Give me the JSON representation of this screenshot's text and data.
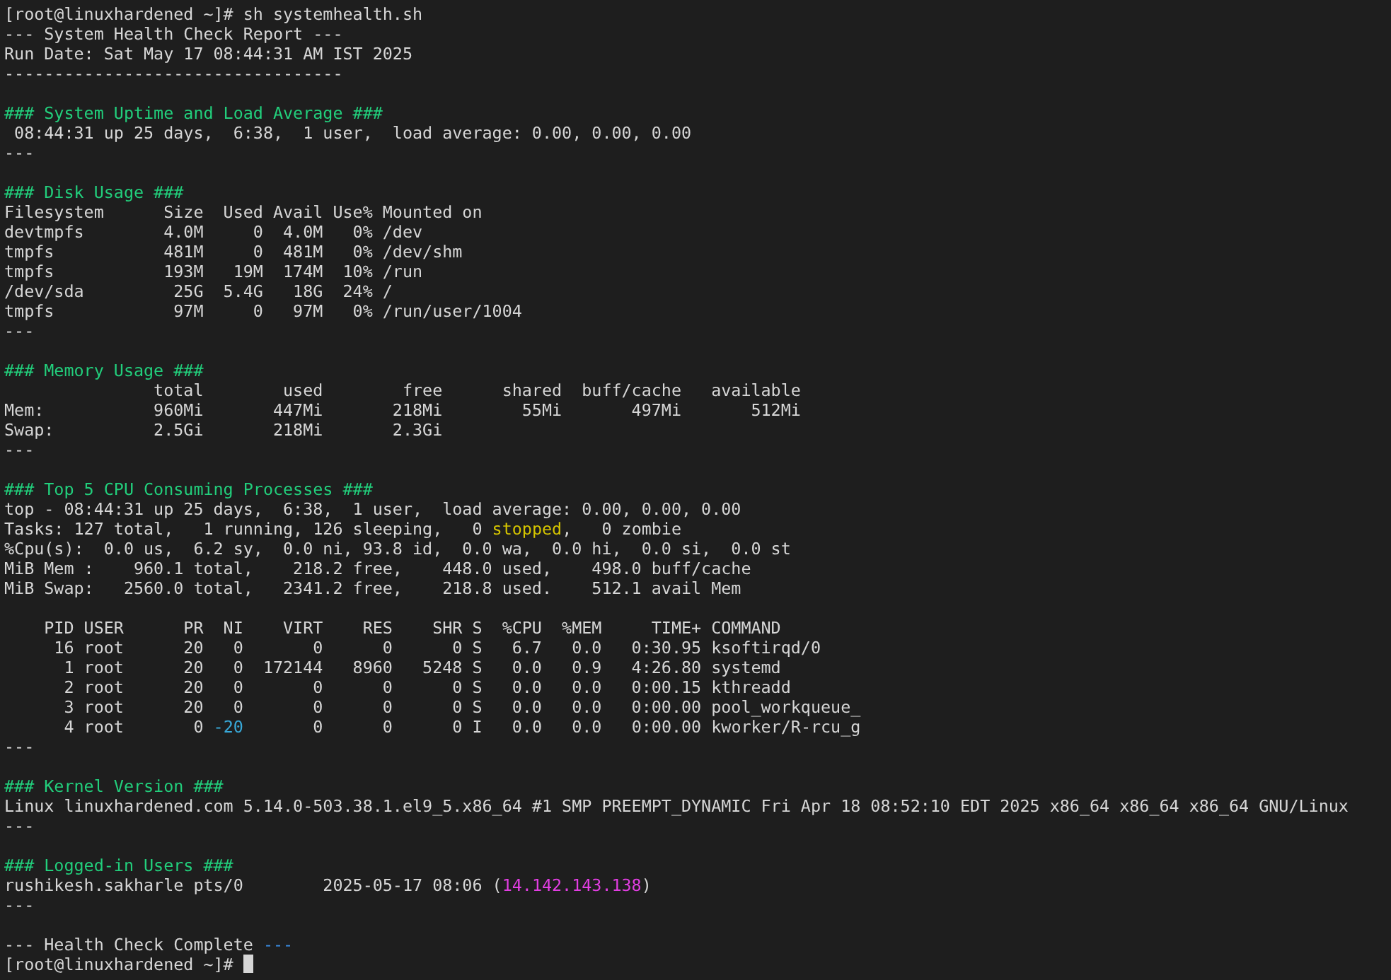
{
  "command_prompt": {
    "prompt": "[root@linuxhardened ~]#",
    "command": "sh systemhealth.sh"
  },
  "report_header": [
    "--- System Health Check Report ---",
    "Run Date: Sat May 17 08:44:31 AM IST 2025",
    "----------------------------------"
  ],
  "sections": [
    {
      "heading": "### System Uptime and Load Average ###",
      "blocks": [
        [
          {
            "parts": [
              {
                "text": " 08:44:31 up 25 days,  6:38,  1 user,  load average: 0.00, 0.00, 0.00",
                "kind": "plain"
              }
            ]
          }
        ]
      ],
      "end": "---"
    },
    {
      "heading": "### Disk Usage ###",
      "blocks": [
        [
          {
            "parts": [
              {
                "text": "Filesystem      Size  Used Avail Use% Mounted on",
                "kind": "plain"
              }
            ]
          },
          {
            "parts": [
              {
                "text": "devtmpfs        4.0M     0  4.0M   0% /dev",
                "kind": "plain"
              }
            ]
          },
          {
            "parts": [
              {
                "text": "tmpfs           481M     0  481M   0% /dev/shm",
                "kind": "plain"
              }
            ]
          },
          {
            "parts": [
              {
                "text": "tmpfs           193M   19M  174M  10% /run",
                "kind": "plain"
              }
            ]
          },
          {
            "parts": [
              {
                "text": "/dev/sda         25G  5.4G   18G  24% /",
                "kind": "plain"
              }
            ]
          },
          {
            "parts": [
              {
                "text": "tmpfs            97M     0   97M   0% /run/user/1004",
                "kind": "plain"
              }
            ]
          }
        ]
      ],
      "end": "---"
    },
    {
      "heading": "### Memory Usage ###",
      "blocks": [
        [
          {
            "parts": [
              {
                "text": "               total        used        free      shared  buff/cache   available",
                "kind": "plain"
              }
            ]
          },
          {
            "parts": [
              {
                "text": "Mem:           960Mi       447Mi       218Mi        55Mi       497Mi       512Mi",
                "kind": "plain"
              }
            ]
          },
          {
            "parts": [
              {
                "text": "Swap:          2.5Gi       218Mi       2.3Gi",
                "kind": "plain"
              }
            ]
          }
        ]
      ],
      "end": "---"
    },
    {
      "heading": "### Top 5 CPU Consuming Processes ###",
      "blocks": [
        [
          {
            "parts": [
              {
                "text": "top - 08:44:31 up 25 days,  6:38,  1 user,  load average: 0.00, 0.00, 0.00",
                "kind": "plain"
              }
            ]
          },
          {
            "parts": [
              {
                "text": "Tasks: 127 total,   1 running, 126 sleeping,   0 ",
                "kind": "plain"
              },
              {
                "text": "stopped",
                "kind": "warning"
              },
              {
                "text": ",   0 zombie",
                "kind": "plain"
              }
            ]
          },
          {
            "parts": [
              {
                "text": "%Cpu(s):  0.0 us,  6.2 sy,  0.0 ni, 93.8 id,  0.0 wa,  0.0 hi,  0.0 si,  0.0 st",
                "kind": "plain"
              }
            ]
          },
          {
            "parts": [
              {
                "text": "MiB Mem :    960.1 total,    218.2 free,    448.0 used,    498.0 buff/cache",
                "kind": "plain"
              }
            ]
          },
          {
            "parts": [
              {
                "text": "MiB Swap:   2560.0 total,   2341.2 free,    218.8 used.    512.1 avail Mem",
                "kind": "plain"
              }
            ]
          }
        ],
        [
          {
            "parts": [
              {
                "text": "    PID USER      PR  NI    VIRT    RES    SHR S  %CPU  %MEM     TIME+ COMMAND",
                "kind": "plain"
              }
            ]
          },
          {
            "parts": [
              {
                "text": "     16 root      20   0       0      0      0 S   6.7   0.0   0:30.95 ksoftirqd/0",
                "kind": "plain"
              }
            ]
          },
          {
            "parts": [
              {
                "text": "      1 root      20   0  172144   8960   5248 S   0.0   0.9   4:26.80 systemd",
                "kind": "plain"
              }
            ]
          },
          {
            "parts": [
              {
                "text": "      2 root      20   0       0      0      0 S   0.0   0.0   0:00.15 kthreadd",
                "kind": "plain"
              }
            ]
          },
          {
            "parts": [
              {
                "text": "      3 root      20   0       0      0      0 S   0.0   0.0   0:00.00 pool_workqueue_",
                "kind": "plain"
              }
            ]
          },
          {
            "parts": [
              {
                "text": "      4 root       0 ",
                "kind": "plain"
              },
              {
                "text": "-20",
                "kind": "number"
              },
              {
                "text": "       0      0      0 I   0.0   0.0   0:00.00 kworker/R-rcu_g",
                "kind": "plain"
              }
            ]
          }
        ]
      ],
      "end": "---"
    },
    {
      "heading": "### Kernel Version ###",
      "blocks": [
        [
          {
            "parts": [
              {
                "text": "Linux linuxhardened.com 5.14.0-503.38.1.el9_5.x86_64 #1 SMP PREEMPT_DYNAMIC Fri Apr 18 08:52:10 EDT 2025 x86_64 x86_64 x86_64 GNU/Linux",
                "kind": "plain"
              }
            ]
          }
        ]
      ],
      "end": "---"
    },
    {
      "heading": "### Logged-in Users ###",
      "blocks": [
        [
          {
            "parts": [
              {
                "text": "rushikesh.sakharle pts/0        2025-05-17 08:06 (",
                "kind": "plain"
              },
              {
                "text": "14.142.143.138",
                "kind": "address"
              },
              {
                "text": ")",
                "kind": "plain"
              }
            ]
          }
        ]
      ],
      "end": "---"
    }
  ],
  "footer": {
    "parts": [
      {
        "text": "--- Health Check Complete ",
        "kind": "plain"
      },
      {
        "text": "---",
        "kind": "accent"
      }
    ]
  },
  "final_prompt": {
    "prompt": "[root@linuxhardened ~]#",
    "cursor": true
  }
}
